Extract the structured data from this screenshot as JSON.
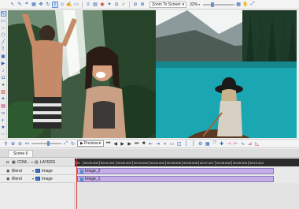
{
  "toolbar": {
    "zoom_select": "Zoom To Screen",
    "zoom_percent": "32%",
    "icons": [
      "select-icon",
      "pen-icon",
      "crop-icon",
      "grid-icon",
      "move-icon",
      "rotate-icon",
      "text-icon",
      "shape-icon",
      "brush-icon",
      "eraser-icon",
      "undo-icon",
      "redo-icon"
    ]
  },
  "transport": {
    "preview_label": "Preview"
  },
  "timeline": {
    "scene_tab": "Scene 6",
    "track_head": {
      "com_label": "COM...",
      "layers_label": "LAYERS"
    },
    "ruler_ticks": [
      "00",
      "00:00.000",
      "00:01.001",
      "00:02.002",
      "00:03.003",
      "00:04.004",
      "00:05.005",
      "00:06.006",
      "00:07.007",
      "00:08.008",
      "00:09.009",
      "00:10.410"
    ],
    "rows": [
      {
        "blend": "Blend",
        "type": "Image",
        "clip": "Image_2"
      },
      {
        "blend": "Blend",
        "type": "Image",
        "clip": "Image_1"
      }
    ]
  }
}
